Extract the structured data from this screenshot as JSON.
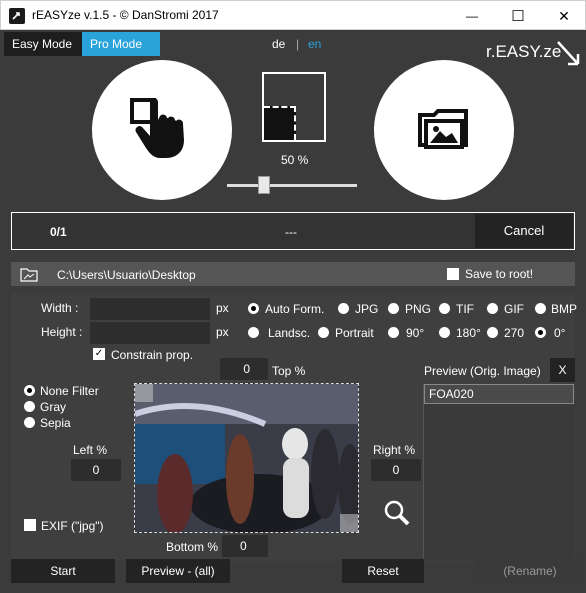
{
  "window": {
    "title": "rEASYze v.1.5 - © DanStromi 2017",
    "minimize_glyph": "—",
    "maximize_glyph": "☐",
    "close_glyph": "✕"
  },
  "modes": {
    "easy": "Easy Mode",
    "pro": "Pro Mode"
  },
  "language": {
    "de": "de",
    "sep": "|",
    "en": "en",
    "active": "en"
  },
  "logo": "r.EASY.ze",
  "scale": {
    "value_label": "50 %",
    "value": 0.5
  },
  "progress": {
    "count": "0/1",
    "status": "---",
    "cancel_label": "Cancel"
  },
  "path": {
    "value": "C:\\Users\\Usuario\\Desktop",
    "save_to_root_label": "Save to root!"
  },
  "size": {
    "width_label": "Width :",
    "height_label": "Height :",
    "px_label": "px",
    "width_value": "",
    "height_value": "",
    "constrain_label": "Constrain prop.",
    "constrain_checked": true
  },
  "formats": [
    "Auto Form.",
    "JPG",
    "PNG",
    "TIF",
    "GIF",
    "BMP"
  ],
  "format_selected": "Auto Form.",
  "orientation": [
    "Landsc.",
    "Portrait",
    "90°",
    "180°",
    "270",
    "0°"
  ],
  "orientation_selected": "0°",
  "filters": [
    "None Filter",
    "Gray",
    "Sepia"
  ],
  "filter_selected": "None Filter",
  "crop": {
    "top_label": "Top %",
    "top_value": "0",
    "left_label": "Left %",
    "left_value": "0",
    "right_label": "Right %",
    "right_value": "0",
    "bottom_label": "Bottom %",
    "bottom_value": "0"
  },
  "exif_label": "EXIF (\"jpg\")",
  "preview": {
    "label": "Preview (Orig. Image)",
    "close": "X",
    "files": [
      "FOA020"
    ]
  },
  "buttons": {
    "start": "Start",
    "preview_all": "Preview - (all)",
    "reset": "Reset",
    "rename": "(Rename)"
  }
}
